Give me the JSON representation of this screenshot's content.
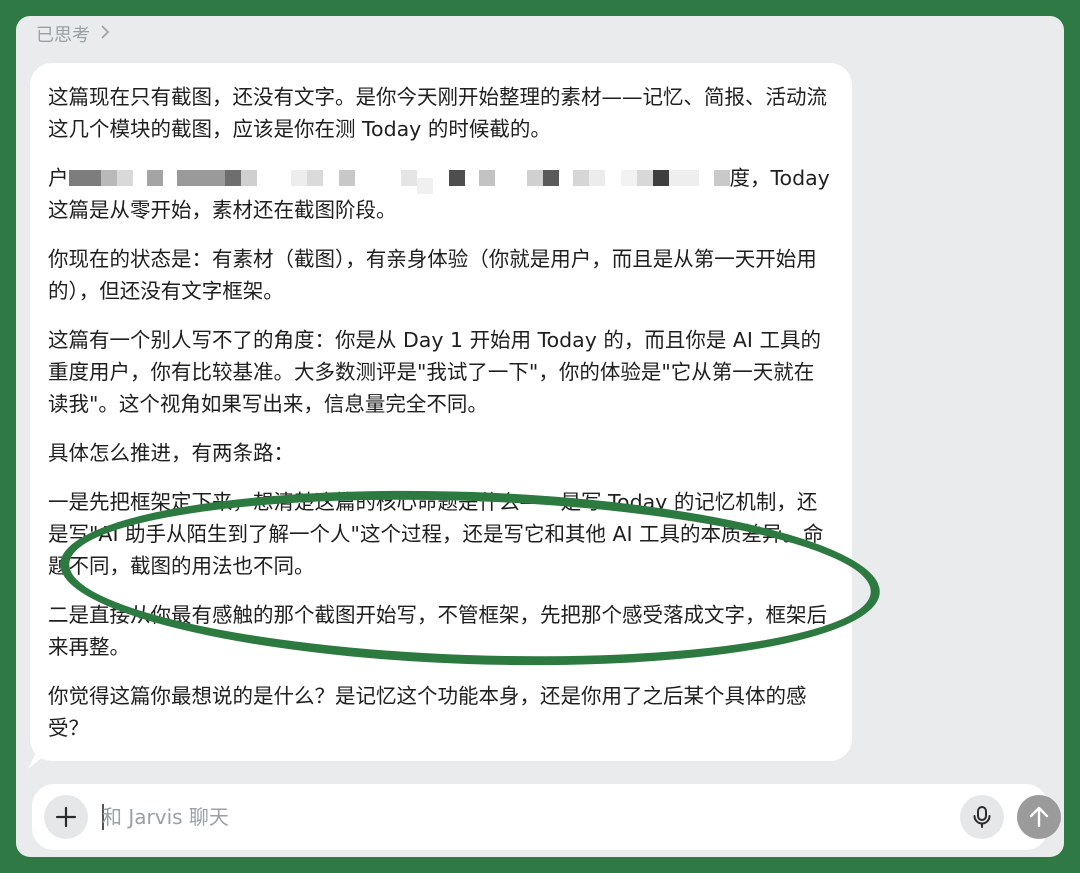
{
  "thought": {
    "label": "已思考",
    "chevron_icon": "chevron-right-icon"
  },
  "message": {
    "paragraphs": [
      "这篇现在只有截图，还没有文字。是你今天刚开始整理的素材——记忆、简报、活动流这几个模块的截图，应该是你在测 Today 的时候截的。",
      "你现在的状态是：有素材（截图），有亲身体验（你就是用户，而且是从第一天开始用的），但还没有文字框架。",
      "这篇有一个别人写不了的角度：你是从 Day 1 开始用 Today 的，而且你是 AI 工具的重度用户，你有比较基准。大多数测评是\"我试了一下\"，你的体验是\"它从第一天就在读我\"。这个视角如果写出来，信息量完全不同。",
      "具体怎么推进，有两条路：",
      "一是先把框架定下来，想清楚这篇的核心命题是什么——是写 Today 的记忆机制，还是写\"AI 助手从陌生到了解一个人\"这个过程，还是写它和其他 AI 工具的本质差异。命题不同，截图的用法也不同。",
      "二是直接从你最有感触的那个截图开始写，不管框架，先把那个感受落成文字，框架后来再整。",
      "你觉得这篇你最想说的是什么？是记忆这个功能本身，还是你用了之后某个具体的感受？"
    ],
    "redacted_lead": "户",
    "redacted_tail": "度，Today",
    "redacted_line2": "这篇是从零开始，素材还在截图阶段。"
  },
  "composer": {
    "placeholder": "和 Jarvis 聊天",
    "value": "",
    "plus_icon": "plus-icon",
    "mic_icon": "microphone-icon",
    "send_icon": "arrow-up-icon"
  },
  "colors": {
    "frame": "#2f7a44",
    "annotation": "#2c7a40",
    "send_disabled": "#9b9b9b"
  }
}
